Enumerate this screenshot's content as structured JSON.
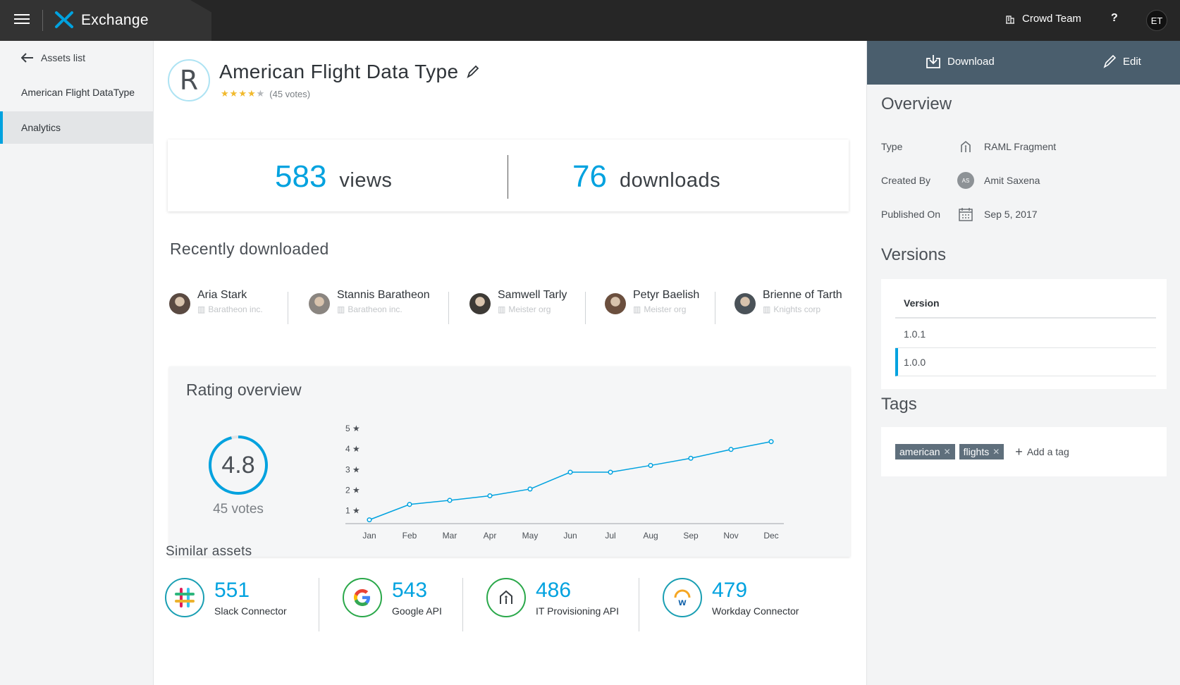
{
  "app": {
    "brand": "Exchange",
    "team": "Crowd Team",
    "help": "?",
    "user_initials": "ET",
    "accent": "#00a2df"
  },
  "sidebar": {
    "back_label": "Assets list",
    "items": [
      {
        "label": "American Flight DataType"
      },
      {
        "label": "Analytics"
      }
    ]
  },
  "asset": {
    "title": "American Flight Data Type",
    "logo_letter": "R",
    "rating_stars": 4,
    "votes_text": "(45 votes)"
  },
  "stats": {
    "views": "583",
    "views_label": "views",
    "downloads": "76",
    "downloads_label": "downloads"
  },
  "recent": {
    "heading": "Recently downloaded",
    "people": [
      {
        "name": "Aria Stark",
        "org": "Baratheon inc.",
        "avatar_color": "#5a4a42"
      },
      {
        "name": "Stannis Baratheon",
        "org": "Baratheon inc.",
        "avatar_color": "#8a8580"
      },
      {
        "name": "Samwell Tarly",
        "org": "Meister org",
        "avatar_color": "#3d3a36"
      },
      {
        "name": "Petyr Baelish",
        "org": "Meister org",
        "avatar_color": "#6b4f3e"
      },
      {
        "name": "Brienne of Tarth",
        "org": "Knights corp",
        "avatar_color": "#4a5258"
      }
    ]
  },
  "rating": {
    "heading": "Rating overview",
    "score": "4.8",
    "score_fraction": 0.96,
    "votes": "45 votes"
  },
  "chart_data": {
    "type": "line",
    "title": "",
    "xlabel": "",
    "ylabel": "",
    "categories": [
      "Jan",
      "Feb",
      "Mar",
      "Apr",
      "May",
      "Jun",
      "Jul",
      "Aug",
      "Sep",
      "Nov",
      "Dec"
    ],
    "y_tick_labels": [
      "1 ★",
      "2 ★",
      "3 ★",
      "4 ★",
      "5 ★"
    ],
    "values": [
      0.55,
      1.3,
      1.5,
      1.72,
      2.05,
      2.87,
      2.87,
      3.2,
      3.55,
      3.98,
      4.36
    ],
    "ylim": [
      0.4,
      5
    ],
    "grid": false,
    "line_color": "#00a2df"
  },
  "similar": {
    "heading": "Similar assets",
    "items": [
      {
        "count": "551",
        "name": "Slack Connector",
        "icon": "slack-icon",
        "ring": "#1a9fb3"
      },
      {
        "count": "543",
        "name": "Google API",
        "icon": "google-icon",
        "ring": "#2aa84a"
      },
      {
        "count": "486",
        "name": "IT Provisioning API",
        "icon": "house-icon",
        "ring": "#2aa84a"
      },
      {
        "count": "479",
        "name": "Workday Connector",
        "icon": "workday-icon",
        "ring": "#1a9fb3"
      }
    ]
  },
  "actions": {
    "download": "Download",
    "edit": "Edit"
  },
  "overview": {
    "heading": "Overview",
    "type_label": "Type",
    "type_value": "RAML Fragment",
    "created_label": "Created By",
    "created_value": "Amit Saxena",
    "created_initials": "AS",
    "published_label": "Published On",
    "published_value": "Sep 5, 2017"
  },
  "versions": {
    "heading": "Versions",
    "column": "Version",
    "rows": [
      "1.0.1",
      "1.0.0"
    ]
  },
  "tags": {
    "heading": "Tags",
    "items": [
      "american",
      "flights"
    ],
    "add_label": "Add a tag"
  }
}
